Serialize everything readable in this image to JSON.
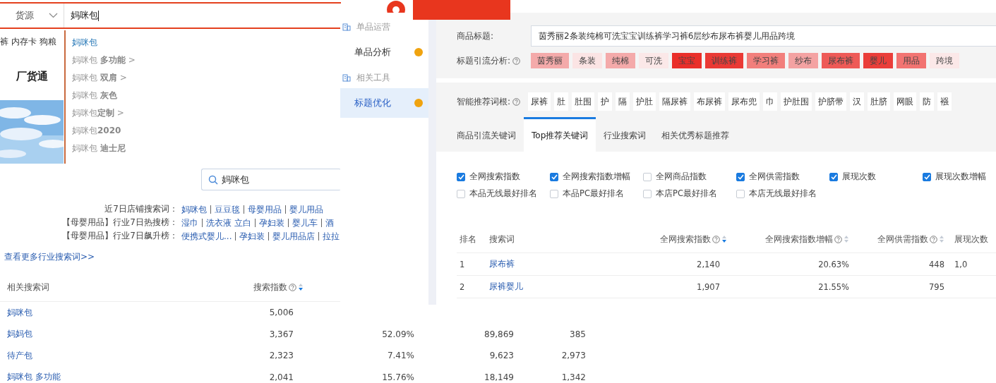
{
  "top_search": {
    "category": "货源",
    "query": "妈咪包",
    "suggestions": [
      {
        "text": "妈咪包",
        "selected": true
      },
      {
        "text": "妈咪包 **多功能** >",
        "selected": false
      },
      {
        "text": "妈咪包 **双肩** >",
        "selected": false
      },
      {
        "text": "妈咪包 **灰色**",
        "selected": false
      },
      {
        "text": "妈咪包**定制** >",
        "selected": false
      },
      {
        "text": "妈咪包**2020**",
        "selected": false
      },
      {
        "text": "妈咪包 **迪士尼**",
        "selected": false
      }
    ]
  },
  "left_nav": [
    "裤",
    "内存卡",
    "狗粮"
  ],
  "brand": "厂货通",
  "search_panel": {
    "query": "妈咪包",
    "hot_lines": [
      {
        "label": "近7日店铺搜索词：",
        "links": [
          "妈咪包",
          "豆豆毯",
          "母婴用品",
          "婴儿用品"
        ]
      },
      {
        "label": "【母婴用品】行业7日热搜榜：",
        "links": [
          "湿巾",
          "洗衣液 立白",
          "孕妇装",
          "婴儿车",
          "酒"
        ]
      },
      {
        "label": "【母婴用品】行业7日飙升榜：",
        "links": [
          "便携式婴儿...",
          "孕妇装",
          "婴儿用品店",
          "拉拉"
        ]
      }
    ],
    "more_link": "查看更多行业搜索词>>"
  },
  "related_table": {
    "columns": [
      {
        "label": "相关搜索词"
      },
      {
        "label": "搜索指数",
        "help": true,
        "sorted": true
      }
    ],
    "rows": [
      [
        "妈咪包",
        "5,006"
      ],
      [
        "妈妈包",
        "3,367",
        "52.09%",
        "89,869",
        "385"
      ],
      [
        "待产包",
        "2,323",
        "7.41%",
        "9,623",
        "2,973"
      ],
      [
        "妈咪包 多功能",
        "2,041",
        "15.76%",
        "18,149",
        "1,342"
      ]
    ]
  },
  "sidebar": {
    "sections": [
      {
        "title": "单品运营",
        "items": [
          {
            "label": "单品分析",
            "selected": false
          }
        ]
      },
      {
        "title": "相关工具",
        "items": [
          {
            "label": "标题优化",
            "selected": true
          }
        ]
      }
    ]
  },
  "title_optimizer": {
    "title_label": "商品标题:",
    "title_value": "茵秀丽2条装纯棉可洗宝宝训练裤学习裤6层纱布尿布裤婴儿用品跨境",
    "analysis_label": "标题引流分析:",
    "tags": [
      {
        "text": "茵秀丽",
        "color": "#f4aaaa"
      },
      {
        "text": "条装",
        "color": "#fbe4e4"
      },
      {
        "text": "纯棉",
        "color": "#f4aaaa"
      },
      {
        "text": "可洗",
        "color": "#fbe8e8"
      },
      {
        "text": "宝宝",
        "color": "#ea2f2a"
      },
      {
        "text": "训练裤",
        "color": "#ea3a35"
      },
      {
        "text": "学习裤",
        "color": "#f27f7c"
      },
      {
        "text": "纱布",
        "color": "#f4a2a2"
      },
      {
        "text": "尿布裤",
        "color": "#ee5a57"
      },
      {
        "text": "婴儿",
        "color": "#ea3e3a"
      },
      {
        "text": "用品",
        "color": "#f27472"
      },
      {
        "text": "跨境",
        "color": "#fbe8e8"
      }
    ],
    "roots_label": "智能推荐词根:",
    "roots": [
      "尿裤",
      "肚",
      "肚围",
      "护",
      "隔",
      "护肚",
      "隔尿裤",
      "布尿裤",
      "尿布兜",
      "巾",
      "护肚围",
      "护脐带",
      "汉",
      "肚脐",
      "网眼",
      "防",
      "襁"
    ],
    "tabs": [
      {
        "label": "商品引流关键词",
        "selected": false
      },
      {
        "label": "Top推荐关键词",
        "selected": true
      },
      {
        "label": "行业搜索词",
        "selected": false
      },
      {
        "label": "相关优秀标题推荐",
        "selected": false
      }
    ],
    "options": [
      {
        "label": "全网搜索指数",
        "checked": true
      },
      {
        "label": "全网搜索指数增幅",
        "checked": true
      },
      {
        "label": "全网商品指数",
        "checked": false
      },
      {
        "label": "全网供需指数",
        "checked": true
      },
      {
        "label": "展现次数",
        "checked": true
      },
      {
        "label": "展现次数增幅",
        "checked": true
      },
      {
        "label": "本品无线最好排名",
        "checked": false
      },
      {
        "label": "本品PC最好排名",
        "checked": false
      },
      {
        "label": "本店PC最好排名",
        "checked": false
      },
      {
        "label": "本店无线最好排名",
        "checked": false
      }
    ],
    "table": {
      "columns": [
        {
          "label": "排名"
        },
        {
          "label": "搜索词"
        },
        {
          "label": "全网搜索指数",
          "help": true,
          "sorted": true
        },
        {
          "label": "全网搜索指数增幅",
          "help": true,
          "sorted": false
        },
        {
          "label": "全网供需指数",
          "help": true,
          "sorted": false
        },
        {
          "label": "展现次数"
        }
      ],
      "rows": [
        [
          "1",
          "尿布裤",
          "2,140",
          "20.63%",
          "448",
          "1,0"
        ],
        [
          "2",
          "尿裤婴儿",
          "1,907",
          "21.55%",
          "795"
        ]
      ]
    }
  }
}
